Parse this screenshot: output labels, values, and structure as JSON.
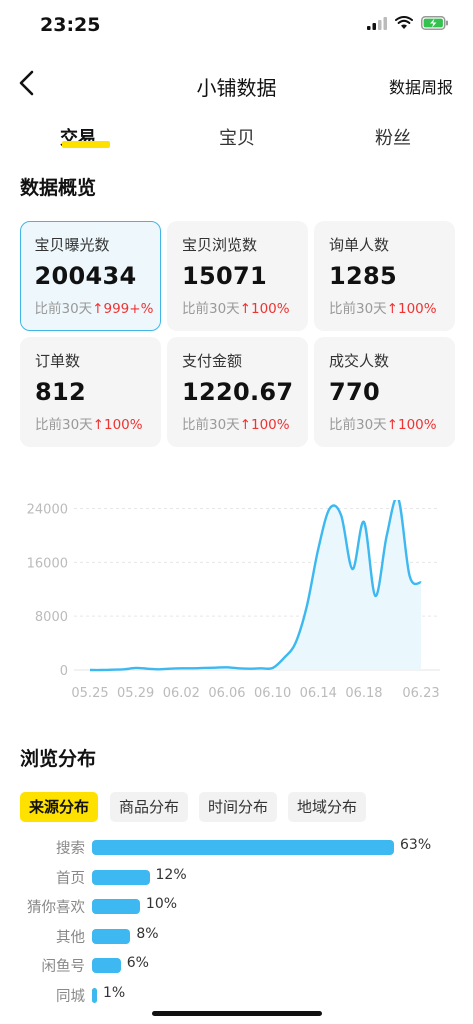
{
  "status_bar": {
    "time": "23:25"
  },
  "nav": {
    "title": "小铺数据",
    "right_link": "数据周报"
  },
  "tabs": [
    {
      "label": "交易",
      "active": true
    },
    {
      "label": "宝贝",
      "active": false
    },
    {
      "label": "粉丝",
      "active": false
    }
  ],
  "overview": {
    "title": "数据概览",
    "cards": [
      {
        "label": "宝贝曝光数",
        "value": "200434",
        "compare": "比前30天",
        "change": "↑999+%",
        "selected": true
      },
      {
        "label": "宝贝浏览数",
        "value": "15071",
        "compare": "比前30天",
        "change": "↑100%",
        "selected": false
      },
      {
        "label": "询单人数",
        "value": "1285",
        "compare": "比前30天",
        "change": "↑100%",
        "selected": false
      },
      {
        "label": "订单数",
        "value": "812",
        "compare": "比前30天",
        "change": "↑100%",
        "selected": false
      },
      {
        "label": "支付金额",
        "value": "1220.67",
        "compare": "比前30天",
        "change": "↑100%",
        "selected": false
      },
      {
        "label": "成交人数",
        "value": "770",
        "compare": "比前30天",
        "change": "↑100%",
        "selected": false
      }
    ]
  },
  "chart_data": {
    "type": "area",
    "x": [
      "05.25",
      "05.26",
      "05.27",
      "05.28",
      "05.29",
      "05.30",
      "05.31",
      "06.01",
      "06.02",
      "06.03",
      "06.04",
      "06.05",
      "06.06",
      "06.07",
      "06.08",
      "06.09",
      "06.10",
      "06.11",
      "06.12",
      "06.13",
      "06.14",
      "06.15",
      "06.16",
      "06.17",
      "06.18",
      "06.19",
      "06.20",
      "06.21",
      "06.22",
      "06.23"
    ],
    "y": [
      0,
      0,
      50,
      100,
      300,
      200,
      100,
      200,
      250,
      250,
      300,
      350,
      400,
      250,
      200,
      250,
      300,
      1800,
      4000,
      9500,
      18000,
      24000,
      23000,
      15000,
      22000,
      11000,
      20000,
      25500,
      14000,
      13000
    ],
    "x_tick_labels": [
      "05.25",
      "05.29",
      "06.02",
      "06.06",
      "06.10",
      "06.14",
      "06.18",
      "06.23"
    ],
    "y_ticks": [
      0,
      8000,
      16000,
      24000
    ],
    "ylim": [
      0,
      27000
    ],
    "title": "",
    "xlabel": "",
    "ylabel": "",
    "grid": true,
    "color": "#3db8f0",
    "fill": "#eaf7fd"
  },
  "distribution": {
    "title": "浏览分布",
    "pills": [
      {
        "label": "来源分布",
        "active": true
      },
      {
        "label": "商品分布",
        "active": false
      },
      {
        "label": "时间分布",
        "active": false
      },
      {
        "label": "地域分布",
        "active": false
      }
    ],
    "bars": [
      {
        "label": "搜索",
        "percent": 63,
        "text": "63%"
      },
      {
        "label": "首页",
        "percent": 12,
        "text": "12%"
      },
      {
        "label": "猜你喜欢",
        "percent": 10,
        "text": "10%"
      },
      {
        "label": "其他",
        "percent": 8,
        "text": "8%"
      },
      {
        "label": "闲鱼号",
        "percent": 6,
        "text": "6%"
      },
      {
        "label": "同城",
        "percent": 1,
        "text": "1%"
      }
    ]
  },
  "colors": {
    "accent": "#ffe100",
    "line": "#3db8f0",
    "up": "#ee3333"
  }
}
